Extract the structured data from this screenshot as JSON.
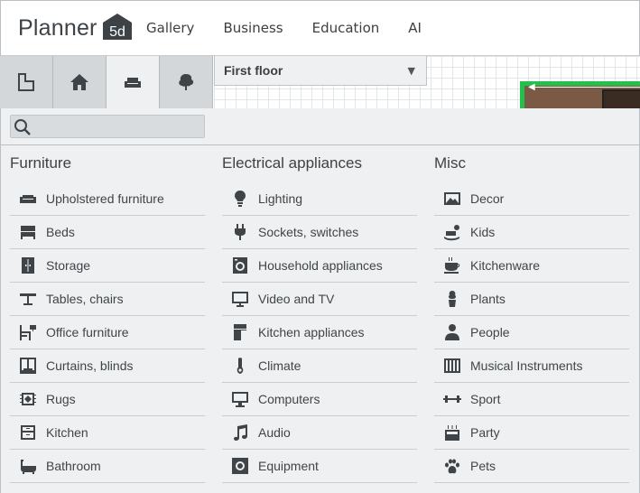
{
  "brand": {
    "name": "Planner",
    "badge": "5d"
  },
  "nav": {
    "links": [
      "Gallery",
      "Business",
      "Education",
      "AI"
    ]
  },
  "toolbar": {
    "tools": [
      "floorplan-icon",
      "house-icon",
      "furniture-icon",
      "tree-icon"
    ],
    "active_tool": "furniture-icon",
    "floor_label": "First floor"
  },
  "search": {
    "placeholder": "",
    "value": ""
  },
  "columns": [
    {
      "title": "Furniture",
      "items": [
        {
          "label": "Upholstered furniture",
          "icon": "sofa-icon"
        },
        {
          "label": "Beds",
          "icon": "bed-icon"
        },
        {
          "label": "Storage",
          "icon": "wardrobe-icon"
        },
        {
          "label": "Tables, chairs",
          "icon": "table-icon"
        },
        {
          "label": "Office furniture",
          "icon": "desk-icon"
        },
        {
          "label": "Curtains, blinds",
          "icon": "curtain-icon"
        },
        {
          "label": "Rugs",
          "icon": "rug-icon"
        },
        {
          "label": "Kitchen",
          "icon": "kitchen-cabinet-icon"
        },
        {
          "label": "Bathroom",
          "icon": "bathtub-icon"
        }
      ]
    },
    {
      "title": "Electrical appliances",
      "items": [
        {
          "label": "Lighting",
          "icon": "bulb-icon"
        },
        {
          "label": "Sockets, switches",
          "icon": "plug-icon"
        },
        {
          "label": "Household appliances",
          "icon": "washing-machine-icon"
        },
        {
          "label": "Video and TV",
          "icon": "tv-icon"
        },
        {
          "label": "Kitchen appliances",
          "icon": "fridge-icon"
        },
        {
          "label": "Climate",
          "icon": "thermometer-icon"
        },
        {
          "label": "Computers",
          "icon": "monitor-icon"
        },
        {
          "label": "Audio",
          "icon": "music-note-icon"
        },
        {
          "label": "Equipment",
          "icon": "gear-icon"
        }
      ]
    },
    {
      "title": "Misc",
      "items": [
        {
          "label": "Decor",
          "icon": "picture-icon"
        },
        {
          "label": "Kids",
          "icon": "rocking-horse-icon"
        },
        {
          "label": "Kitchenware",
          "icon": "teacup-icon"
        },
        {
          "label": "Plants",
          "icon": "potted-plant-icon"
        },
        {
          "label": "People",
          "icon": "person-icon"
        },
        {
          "label": "Musical Instruments",
          "icon": "piano-icon"
        },
        {
          "label": "Sport",
          "icon": "dumbbell-icon"
        },
        {
          "label": "Party",
          "icon": "cake-icon"
        },
        {
          "label": "Pets",
          "icon": "paw-icon"
        }
      ]
    }
  ]
}
